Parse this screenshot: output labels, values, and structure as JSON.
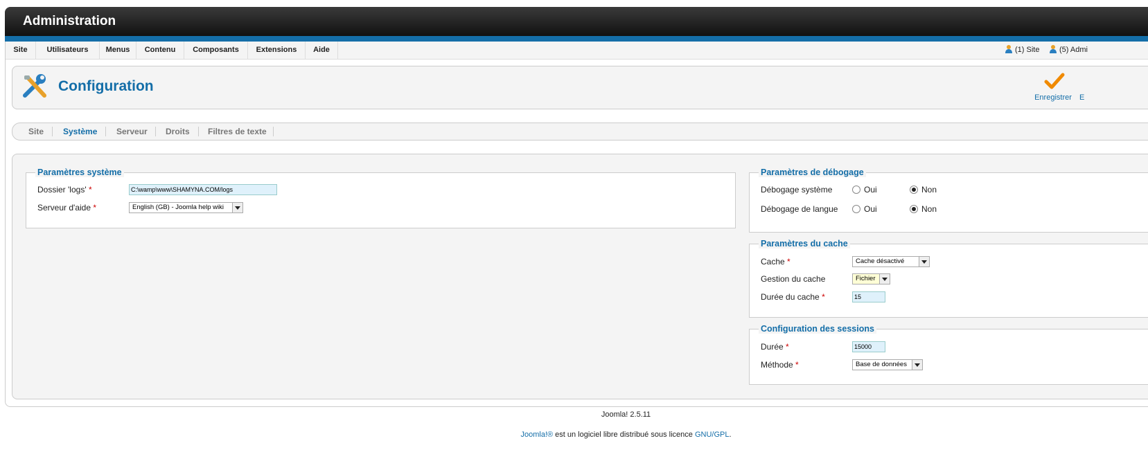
{
  "header": {
    "title": "Administration"
  },
  "menu": {
    "items": [
      "Site",
      "Utilisateurs",
      "Menus",
      "Contenu",
      "Composants",
      "Extensions",
      "Aide"
    ]
  },
  "status": {
    "site": "(1) Site",
    "admin": "(5) Admi"
  },
  "page": {
    "title": "Configuration"
  },
  "toolbar": {
    "save_label": "Enregistrer",
    "next_label": "E"
  },
  "tabs": [
    "Site",
    "Système",
    "Serveur",
    "Droits",
    "Filtres de texte"
  ],
  "system": {
    "legend": "Paramètres système",
    "logs_label": "Dossier 'logs'",
    "logs_value": "C:\\wamp\\www\\SHAMYNA.COM/logs",
    "help_label": "Serveur d'aide",
    "help_value": "English (GB) - Joomla help wiki"
  },
  "debug": {
    "legend": "Paramètres de débogage",
    "system_label": "Débogage système",
    "lang_label": "Débogage de langue",
    "yes": "Oui",
    "no": "Non"
  },
  "cache": {
    "legend": "Paramètres du cache",
    "cache_label": "Cache",
    "cache_value": "Cache désactivé",
    "handler_label": "Gestion du cache",
    "handler_value": "Fichier",
    "time_label": "Durée du cache",
    "time_value": "15"
  },
  "session": {
    "legend": "Configuration des sessions",
    "lifetime_label": "Durée",
    "lifetime_value": "15000",
    "handler_label": "Méthode",
    "handler_value": "Base de données"
  },
  "footer": {
    "version": "Joomla! 2.5.11",
    "brand": "Joomla!®",
    "license_text": " est un logiciel libre distribué sous licence ",
    "license_link": "GNU/GPL",
    "period": "."
  },
  "colors": {
    "accent": "#146ea8",
    "required": "#cc0000",
    "header_dark": "#111111"
  }
}
